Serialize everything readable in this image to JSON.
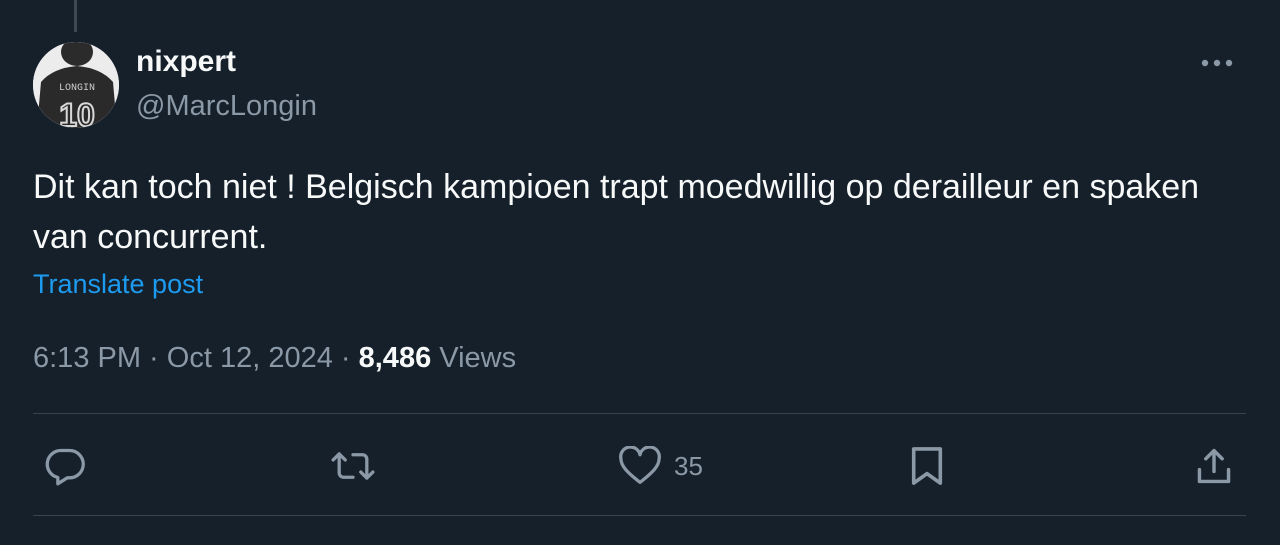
{
  "author": {
    "display_name": "nixpert",
    "handle": "@MarcLongin",
    "avatar_jersey_name": "LONGIN",
    "avatar_jersey_number": "10"
  },
  "tweet": {
    "text": "Dit kan toch niet ! Belgisch kampioen trapt moedwillig op derailleur en spaken van concurrent.",
    "translate_label": "Translate post",
    "time": "6:13 PM",
    "separator": " · ",
    "date": "Oct 12, 2024",
    "views_count": "8,486",
    "views_label": " Views"
  },
  "actions": {
    "reply": {
      "icon": "reply-icon"
    },
    "repost": {
      "icon": "repost-icon"
    },
    "like": {
      "icon": "heart-icon",
      "count": "35"
    },
    "bookmark": {
      "icon": "bookmark-icon"
    },
    "share": {
      "icon": "share-icon"
    }
  },
  "colors": {
    "background": "#15202b",
    "primary_text": "#f7f9f9",
    "secondary_text": "#8b98a5",
    "link": "#1d9bf0",
    "divider": "#38444d"
  }
}
